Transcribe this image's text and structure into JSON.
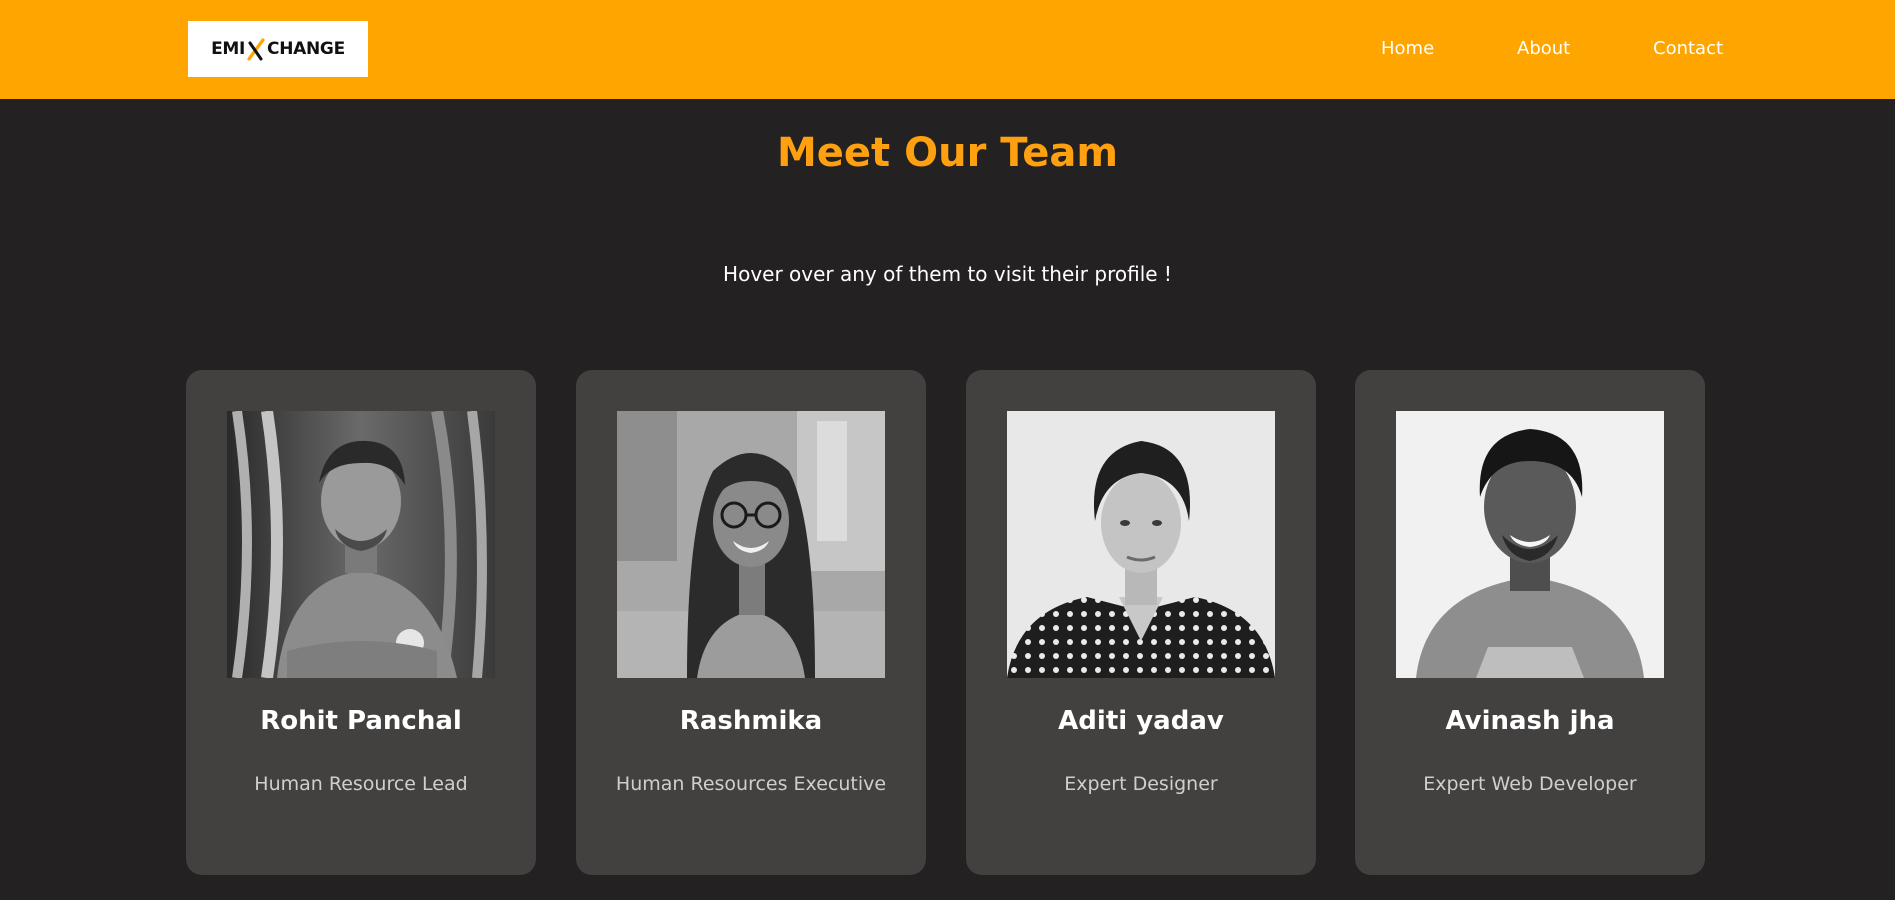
{
  "header": {
    "logo_left": "EMI",
    "logo_right": "CHANGE",
    "nav": [
      {
        "label": "Home"
      },
      {
        "label": "About"
      },
      {
        "label": "Contact"
      }
    ],
    "colors": {
      "bar": "#ffa500",
      "logo_bg": "#ffffff"
    }
  },
  "main": {
    "title": "Meet Our Team",
    "subtitle": "Hover over any of them to visit their profile !",
    "colors": {
      "background": "#232122",
      "title": "#ffa010",
      "card": "#434140"
    }
  },
  "team": [
    {
      "name": "Rohit Panchal",
      "role": "Human Resource Lead"
    },
    {
      "name": "Rashmika",
      "role": "Human Resources Executive"
    },
    {
      "name": "Aditi yadav",
      "role": "Expert Designer"
    },
    {
      "name": "Avinash jha",
      "role": "Expert Web Developer"
    }
  ]
}
